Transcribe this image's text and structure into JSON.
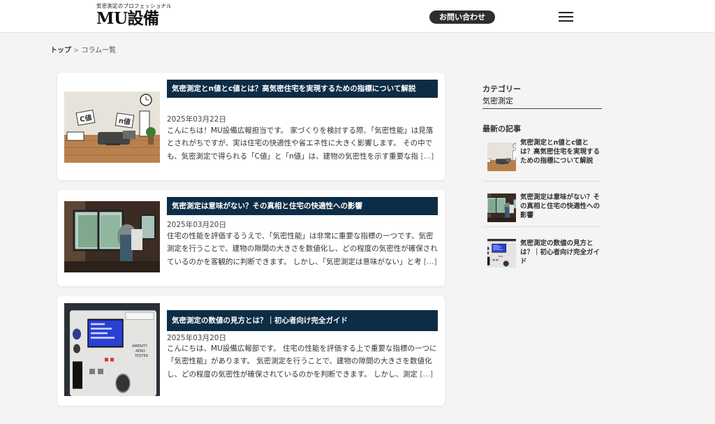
{
  "header": {
    "tagline": "気密測定のプロフェッショナル",
    "brand": "MU設備",
    "contact_label": "お問い合わせ"
  },
  "breadcrumb": {
    "home": "トップ",
    "separator": ">",
    "current": "コラム一覧"
  },
  "articles": [
    {
      "title": "気密測定とn値とc値とは？高気密住宅を実現するための指標について解説",
      "date": "2025年03月22日",
      "excerpt": "こんにちは！MU設備広報担当です。 家づくりを検討する際、「気密性能」は見落とされがちですが、実は住宅の快適性や省エネ性に大きく影響します。 その中でも、気密測定で得られる「C値」と「n値」は、建物の気密性を示す重要な指",
      "more": "[…]",
      "thumb_labels": [
        "C値",
        "n値"
      ]
    },
    {
      "title": "気密測定は意味がない？その真相と住宅の快適性への影響",
      "date": "2025年03月20日",
      "excerpt": "住宅の性能を評価するうえで、「気密性能」は非常に重要な指標の一つです。気密測定を行うことで、建物の隙間の大きさを数値化し、どの程度の気密性が確保されているのかを客観的に判断できます。 しかし、「気密測定は意味がない」と考",
      "more": "[…]"
    },
    {
      "title": "気密測定の数値の見方とは？｜初心者向け完全ガイド",
      "date": "2025年03月20日",
      "excerpt": "こんにちは、MU設備広報部です。 住宅の性能を評価する上で重要な指標の一つに「気密性能」があります。 気密測定を行うことで、建物の隙間の大きさを数値化し、どの程度の気密性が確保されているのかを判断できます。 しかし、測定",
      "more": "[…]",
      "thumb_labels": [
        "AMENITY",
        "AERO",
        "TESTER"
      ]
    }
  ],
  "sidebar": {
    "category_heading": "カテゴリー",
    "category_item": "気密測定",
    "recent_heading": "最新の記事",
    "recent": [
      {
        "title": "気密測定とn値とc値とは？高気密住宅を実現するための指標について解説"
      },
      {
        "title": "気密測定は意味がない？その真相と住宅の快適性への影響"
      },
      {
        "title": "気密測定の数値の見方とは？｜初心者向け完全ガイド"
      }
    ]
  },
  "colors": {
    "title_bar": "#0d2d46",
    "page_background": "#f4f4f4",
    "contact_button": "#2e2e2e"
  }
}
